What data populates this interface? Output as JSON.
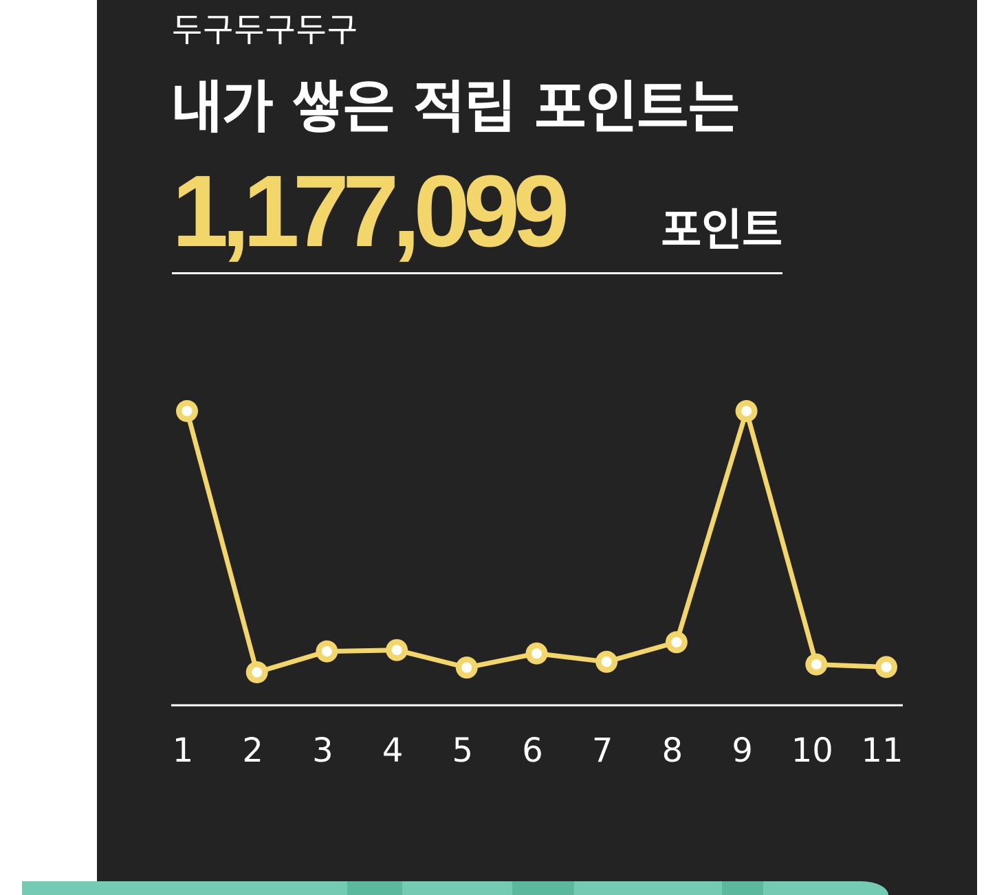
{
  "header": {
    "subtitle": "두구두구두구",
    "title": "내가 쌓은 적립 포인트는",
    "points_value": "1,177,099",
    "points_unit": "포인트"
  },
  "colors": {
    "background": "#232323",
    "accent": "#f2d66a",
    "text": "#ffffff",
    "footer": "#74cbb4"
  },
  "chart_data": {
    "type": "line",
    "title": "",
    "xlabel": "",
    "ylabel": "",
    "grid": false,
    "categories": [
      "1",
      "2",
      "3",
      "4",
      "5",
      "6",
      "7",
      "8",
      "9",
      "10",
      "11"
    ],
    "series": [
      {
        "values": [
          100,
          0,
          8,
          8.5,
          1.8,
          7.2,
          4,
          11.5,
          100,
          3,
          2
        ]
      }
    ],
    "ylim": [
      0,
      100
    ]
  }
}
